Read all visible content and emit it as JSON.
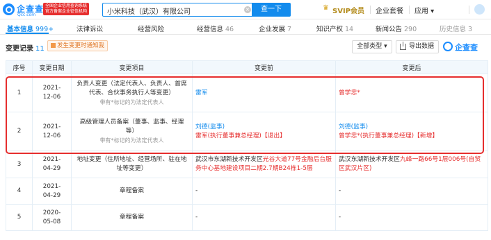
{
  "header": {
    "logo_cn": "企查查",
    "logo_en": "Qcc.com",
    "promo_line1": "全国企业信用查询系统",
    "promo_line2": "官方备案企业征信机构",
    "search_value": "小米科技（武汉）有限公司",
    "search_button": "查一下",
    "svip": "SVIP会员",
    "nav": [
      "企业套餐",
      "应用 ▾"
    ]
  },
  "tabs": [
    {
      "label": "基本信息",
      "count": "999+"
    },
    {
      "label": "法律诉讼",
      "count": ""
    },
    {
      "label": "经营风险",
      "count": ""
    },
    {
      "label": "经营信息",
      "count": "46"
    },
    {
      "label": "企业发展",
      "count": "7"
    },
    {
      "label": "知识产权",
      "count": "14"
    },
    {
      "label": "新闻公告",
      "count": "290"
    },
    {
      "label": "历史信息",
      "count": "3"
    }
  ],
  "section": {
    "title": "变更记录",
    "count": "11",
    "legal_tag": "发生变更时通知我",
    "filter_button": "全部类型 ▾",
    "export_button": "导出数据",
    "watermark": "企查查"
  },
  "table": {
    "headers": [
      "序号",
      "变更日期",
      "变更项目",
      "变更前",
      "变更后"
    ],
    "rows": [
      {
        "idx": "1",
        "date": "2021-12-06",
        "item": "负责人变更（法定代表人、负责人、首席代表、合伙事务执行人等变更）",
        "note": "带有*标记的为法定代表人",
        "before": "雷军",
        "after": "曾学忠*"
      },
      {
        "idx": "2",
        "date": "2021-12-06",
        "item": "高级管理人员备案（董事、监事、经理等）",
        "note": "带有*标记的为法定代表人",
        "before_line1": "刘德(监事)",
        "before_line2": "雷军(执行董事兼总经理)【退出】",
        "after_line1": "刘德(监事)",
        "after_line2": "曾学忠*(执行董事兼总经理)【新增】"
      },
      {
        "idx": "3",
        "date": "2021-04-29",
        "item": "地址变更（住所地址、经营场所、驻在地址等变更）",
        "before_a": "武汉市东湖新技术开发区",
        "before_b": "光谷大道77号金融后台服务中心基地建设项目二期2.7期B24栋1-5层",
        "after_a": "武汉东湖新技术开发区",
        "after_b": "九峰一路66号1层006号(自贸区武汉片区)"
      },
      {
        "idx": "4",
        "date": "2021-04-29",
        "item": "章程备案",
        "before": "-",
        "after": "-"
      },
      {
        "idx": "5",
        "date": "2020-05-08",
        "item": "章程备案",
        "before": "-",
        "after": "-"
      }
    ]
  }
}
